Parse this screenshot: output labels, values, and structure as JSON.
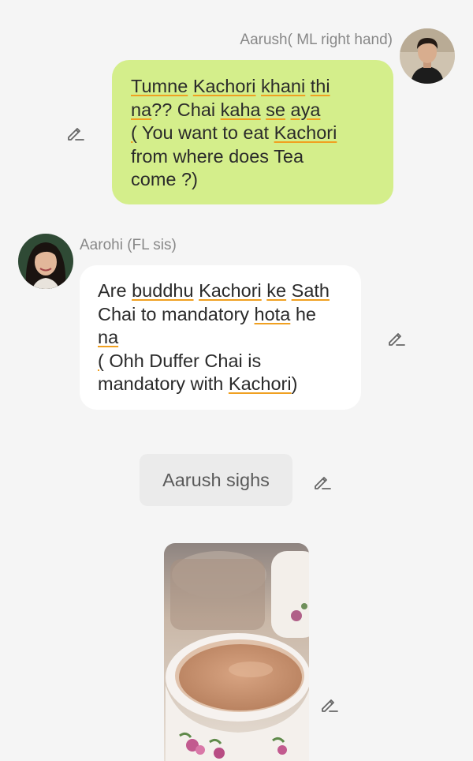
{
  "messages": [
    {
      "type": "outgoing",
      "sender": "Aarush( ML right hand)",
      "lines": [
        "Tumne Kachori khani thi",
        "na?? Chai kaha se aya",
        "( You want to eat Kachori",
        "from where does Tea",
        "come ?)"
      ]
    },
    {
      "type": "incoming",
      "sender": "Aarohi (FL sis)",
      "lines": [
        "Are buddhu Kachori ke Sath",
        "Chai to mandatory hota he",
        "na",
        "( Ohh Duffer Chai is",
        "mandatory with Kachori)"
      ]
    },
    {
      "type": "narration",
      "text": "Aarush sighs"
    },
    {
      "type": "image",
      "subject": "cup of chai"
    }
  ],
  "icons": {
    "edit": "pencil-edit-icon"
  },
  "colors": {
    "background": "#f5f5f5",
    "outgoing_bubble": "#d4ee8b",
    "incoming_bubble": "#ffffff",
    "narration_bubble": "#ebebeb",
    "spellcheck_underline": "#f0a020"
  }
}
